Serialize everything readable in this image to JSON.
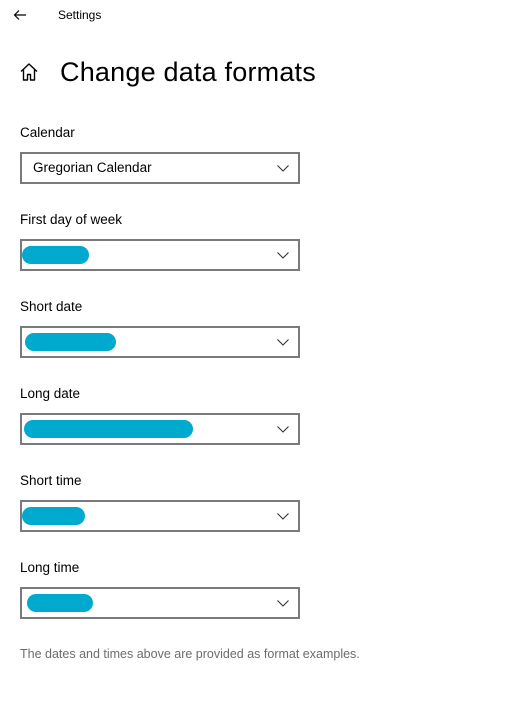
{
  "window": {
    "app_title": "Settings",
    "back_icon": "arrow-left-icon"
  },
  "header": {
    "home_icon": "home-icon",
    "title": "Change data formats"
  },
  "fields": [
    {
      "label": "Calendar",
      "value": "Gregorian Calendar",
      "redacted": false
    },
    {
      "label": "First day of week",
      "value": "",
      "redacted": true
    },
    {
      "label": "Short date",
      "value": "",
      "redacted": true
    },
    {
      "label": "Long date",
      "value": "",
      "redacted": true
    },
    {
      "label": "Short time",
      "value": "",
      "redacted": true
    },
    {
      "label": "Long time",
      "value": "",
      "redacted": true
    }
  ],
  "footnote": "The dates and times above are provided as format examples.",
  "colors": {
    "redaction": "#00a9ce",
    "border": "#7a7a7a",
    "footnote_text": "#6d6d6d"
  }
}
